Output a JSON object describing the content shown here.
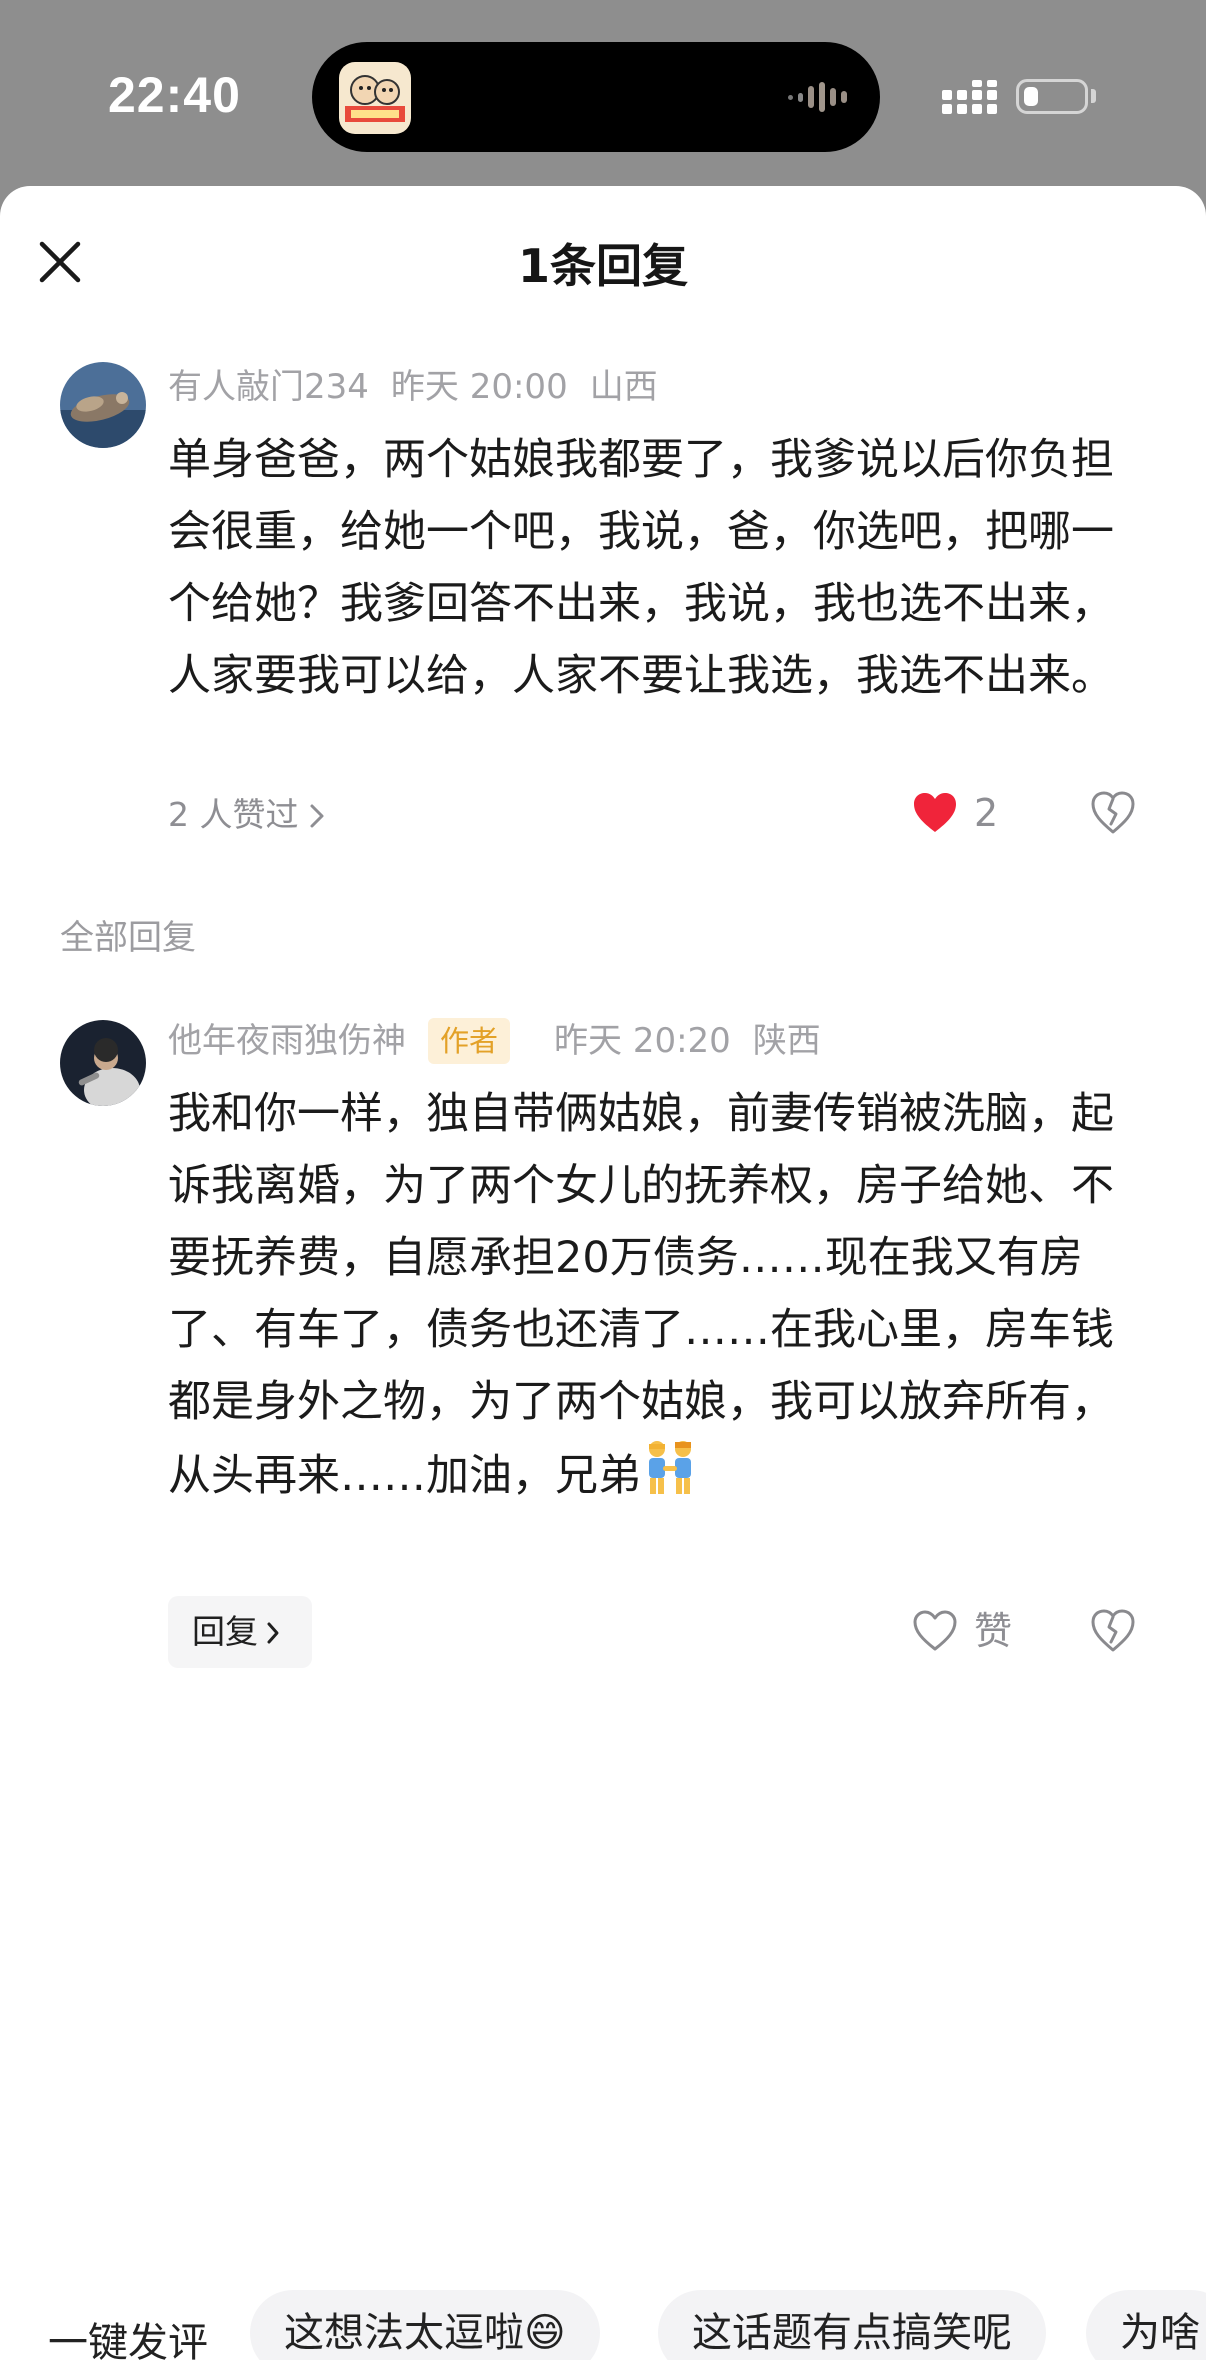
{
  "status_bar": {
    "time": "22:40"
  },
  "sheet": {
    "title": "1条回复",
    "section_label": "全部回复"
  },
  "parent_comment": {
    "username": "有人敲门234",
    "time": "昨天 20:00",
    "location": "山西",
    "text": "单身爸爸，两个姑娘我都要了，我爹说以后你负担会很重，给她一个吧，我说，爸，你选吧，把哪一个给她？我爹回答不出来，我说，我也选不出来，人家要我可以给，人家不要让我选，我选不出来。",
    "likers": "2 人赞过",
    "like_count": "2",
    "liked": true,
    "like_color": "#f0243a"
  },
  "reply": {
    "username": "他年夜雨独伤神",
    "tag": "作者",
    "time": "昨天 20:20",
    "location": "陕西",
    "text": "我和你一样，独自带俩姑娘，前妻传销被洗脑，起诉我离婚，为了两个女儿的抚养权，房子给她、不要抚养费，自愿承担20万债务……现在我又有房了、有车了，债务也还清了……在我心里，房车钱都是身外之物，为了两个姑娘，我可以放弃所有，从头再来……加油，兄弟",
    "emoji": "couple-emoji",
    "reply_label": "回复",
    "like_label": "赞"
  },
  "quick_replies": {
    "label": "一键发评",
    "chips": [
      "这想法太逗啦😄",
      "这话题有点搞笑呢",
      "为啥"
    ]
  },
  "icons": {
    "close": "close-icon",
    "heart": "heart-icon",
    "dislike": "broken-heart-icon",
    "chevron": "chevron-right-icon"
  }
}
